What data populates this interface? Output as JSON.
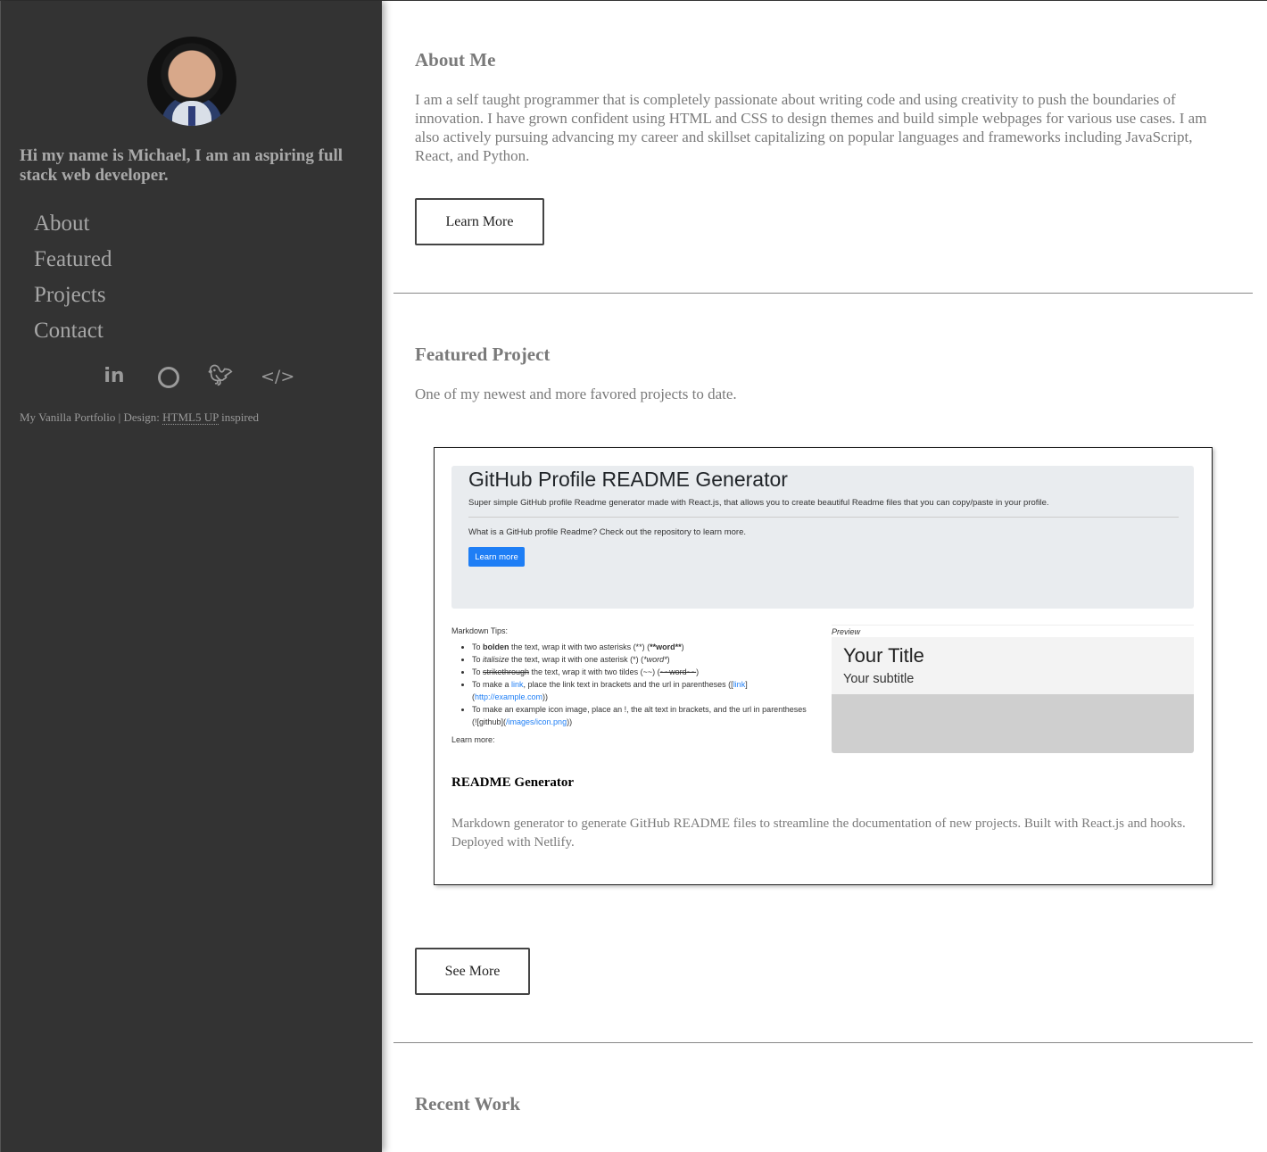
{
  "sidebar": {
    "intro": "Hi my name is Michael, I am an aspiring full stack web developer.",
    "nav": [
      "About",
      "Featured",
      "Projects",
      "Contact"
    ],
    "social": [
      "linkedin-icon",
      "github-icon",
      "twitter-icon",
      "code-icon"
    ],
    "social_glyphs": {
      "linkedin": "in",
      "twitter": "🐦",
      "code": "</>"
    },
    "footer_prefix": "My Vanilla Portfolio | Design: ",
    "footer_abbr": "HTML5 UP",
    "footer_suffix": " inspired"
  },
  "about": {
    "heading": "About Me",
    "body": "I am a self taught programmer that is completely passionate about writing code and using creativity to push the boundaries of innovation. I have grown confident using HTML and CSS to design themes and build simple webpages for various use cases. I am also actively pursuing advancing my career and skillset capitalizing on popular languages and frameworks including JavaScript, React, and Python.",
    "button": "Learn More"
  },
  "featured": {
    "heading": "Featured Project",
    "subtitle": "One of my newest and more favored projects to date.",
    "screenshot": {
      "title": "GitHub Profile README Generator",
      "subtitle": "Super simple GitHub profile Readme generator made with React.js, that allows you to create beautiful Readme files that you can copy/paste in your profile.",
      "question": "What is a GitHub profile Readme? Check out the repository to learn more.",
      "button": "Learn more",
      "tips_title": "Markdown Tips:",
      "tips": [
        "To bolden the text, wrap it with two asterisks (**) (**word**)",
        "To italisize the text, wrap it with one asterisk (*) (*word*)",
        "To strikethrough the text, wrap it with two tildes (~~) (~~word~~)",
        "To make a link, place the link text in brackets and the url in parentheses ([link](http://example.com))",
        "To make an example icon image, place an !, the alt text in brackets, and the url in parentheses (![github](/images/icon.png))"
      ],
      "learn_more": "Learn more:",
      "preview_label": "Preview",
      "preview_title": "Your Title",
      "preview_subtitle": "Your subtitle"
    },
    "card_title": "README Generator",
    "card_desc": "Markdown generator to generate GitHub README files to streamline the documentation of new projects. Built with React.js and hooks. Deployed with Netlify.",
    "button": "See More"
  },
  "recent": {
    "heading": "Recent Work"
  },
  "colors": {
    "sidebar_bg": "#333333",
    "accent_blue": "#1e7ef5",
    "text_gray": "#7a7a7a"
  }
}
